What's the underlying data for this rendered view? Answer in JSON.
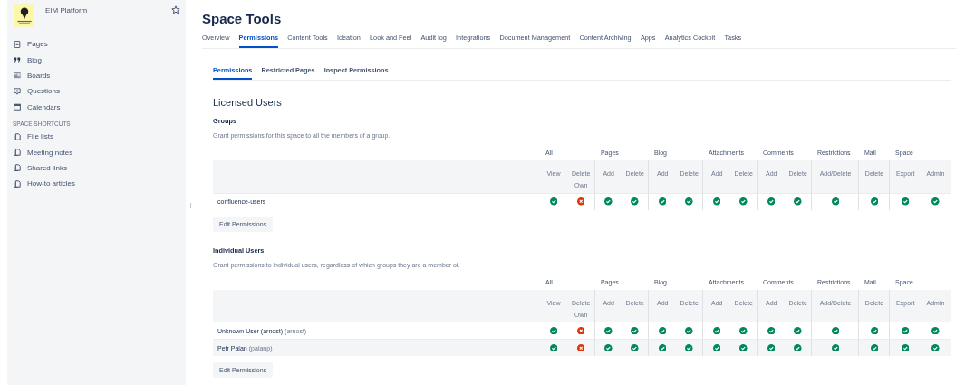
{
  "sidebar": {
    "space_name": "EIM Platform",
    "items": [
      {
        "label": "Pages",
        "kind": "pages"
      },
      {
        "label": "Blog",
        "kind": "blog"
      },
      {
        "label": "Boards",
        "kind": "boards"
      },
      {
        "label": "Questions",
        "kind": "questions"
      },
      {
        "label": "Calendars",
        "kind": "calendars"
      }
    ],
    "shortcuts_heading": "SPACE SHORTCUTS",
    "shortcuts": [
      "File lists",
      "Meeting notes",
      "Shared links",
      "How-to articles"
    ]
  },
  "page_title": "Space Tools",
  "tabs": [
    {
      "label": "Overview",
      "selected": false
    },
    {
      "label": "Permissions",
      "selected": true
    },
    {
      "label": "Content Tools",
      "selected": false
    },
    {
      "label": "Ideation",
      "selected": false
    },
    {
      "label": "Look and Feel",
      "selected": false
    },
    {
      "label": "Audit log",
      "selected": false
    },
    {
      "label": "Integrations",
      "selected": false
    },
    {
      "label": "Document Management",
      "selected": false
    },
    {
      "label": "Content Archiving",
      "selected": false
    },
    {
      "label": "Apps",
      "selected": false
    },
    {
      "label": "Analytics Cockpit",
      "selected": false
    },
    {
      "label": "Tasks",
      "selected": false
    }
  ],
  "subtabs": [
    {
      "label": "Permissions",
      "selected": true
    },
    {
      "label": "Restricted Pages",
      "selected": false
    },
    {
      "label": "Inspect Permissions",
      "selected": false
    }
  ],
  "section_title": "Licensed Users",
  "sections": [
    {
      "title": "Groups",
      "description": "Grant permissions for this space to all the members of a group.",
      "column_groups": [
        {
          "label": "All",
          "columns": [
            "View",
            "Delete Own"
          ]
        },
        {
          "label": "Pages",
          "columns": [
            "Add",
            "Delete"
          ]
        },
        {
          "label": "Blog",
          "columns": [
            "Add",
            "Delete"
          ]
        },
        {
          "label": "Attachments",
          "columns": [
            "Add",
            "Delete"
          ]
        },
        {
          "label": "Comments",
          "columns": [
            "Add",
            "Delete"
          ]
        },
        {
          "label": "Restrictions",
          "columns": [
            "Add/Delete"
          ]
        },
        {
          "label": "Mail",
          "columns": [
            "Delete"
          ]
        },
        {
          "label": "Space",
          "columns": [
            "Export",
            "Admin"
          ]
        }
      ],
      "rows": [
        {
          "name": "confluence-users",
          "permissions": [
            true,
            false,
            true,
            true,
            true,
            true,
            true,
            true,
            true,
            true,
            true,
            true,
            true,
            true
          ]
        }
      ],
      "button": "Edit Permissions"
    },
    {
      "title": "Individual Users",
      "description": "Grant permissions to individual users, regardless of which groups they are a member of.",
      "column_groups": [
        {
          "label": "All",
          "columns": [
            "View",
            "Delete Own"
          ]
        },
        {
          "label": "Pages",
          "columns": [
            "Add",
            "Delete"
          ]
        },
        {
          "label": "Blog",
          "columns": [
            "Add",
            "Delete"
          ]
        },
        {
          "label": "Attachments",
          "columns": [
            "Add",
            "Delete"
          ]
        },
        {
          "label": "Comments",
          "columns": [
            "Add",
            "Delete"
          ]
        },
        {
          "label": "Restrictions",
          "columns": [
            "Add/Delete"
          ]
        },
        {
          "label": "Mail",
          "columns": [
            "Delete"
          ]
        },
        {
          "label": "Space",
          "columns": [
            "Export",
            "Admin"
          ]
        }
      ],
      "rows": [
        {
          "name": "Unknown User (arnost)",
          "username": "(arnost)",
          "permissions": [
            true,
            false,
            true,
            true,
            true,
            true,
            true,
            true,
            true,
            true,
            true,
            true,
            true,
            true
          ]
        },
        {
          "name": "Petr Palan",
          "username": "(palanp)",
          "permissions": [
            true,
            false,
            true,
            true,
            true,
            true,
            true,
            true,
            true,
            true,
            true,
            true,
            true,
            true
          ]
        }
      ],
      "button": "Edit Permissions"
    }
  ]
}
